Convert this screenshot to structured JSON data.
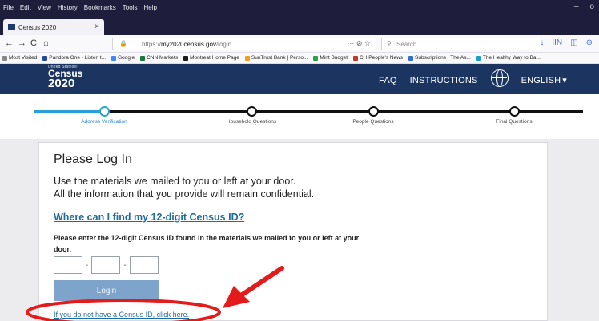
{
  "browser": {
    "menu": [
      "File",
      "Edit",
      "View",
      "History",
      "Bookmarks",
      "Tools",
      "Help"
    ],
    "window_controls": [
      "–",
      "o"
    ],
    "tab": {
      "title": "Census 2020",
      "close": "×"
    },
    "new_tab": "+",
    "nav": {
      "back": "←",
      "forward": "→",
      "reload": "C",
      "home": "⌂"
    },
    "url": {
      "prefix": "https://",
      "host": "my2020census.gov",
      "path": "/login"
    },
    "page_actions": "··· ⊘ ☆",
    "search_placeholder": "Search",
    "toolbar_icons": [
      "↓",
      "IIN",
      "◫",
      "⊕"
    ],
    "bookmarks": [
      {
        "label": "Most Visited",
        "color": "#888888"
      },
      {
        "label": "Pandora One - Listen t...",
        "color": "#224a9c"
      },
      {
        "label": "Google",
        "color": "#4285f4"
      },
      {
        "label": "CNN Markets",
        "color": "#1a7a3a"
      },
      {
        "label": "Montreat Home Page",
        "color": "#1a1a1a"
      },
      {
        "label": "SunTrust Bank | Perso...",
        "color": "#f0a020"
      },
      {
        "label": "Mint Budget",
        "color": "#2ea043"
      },
      {
        "label": "CH People's News",
        "color": "#c0392b"
      },
      {
        "label": "Subscriptions | The As...",
        "color": "#2e6fd8"
      },
      {
        "label": "The Healthy Way to Ba...",
        "color": "#1aa0c8"
      }
    ]
  },
  "site": {
    "logo": {
      "united": "United States®",
      "census": "Census",
      "year": "2020"
    },
    "nav": {
      "faq": "FAQ",
      "instructions": "INSTRUCTIONS",
      "language": "ENGLISH",
      "caret": "▾"
    },
    "colors": {
      "header": "#1c3560",
      "accent": "#2a9fd8",
      "link": "#1e6c9e",
      "button": "#7fa4cc"
    },
    "steps": [
      {
        "label": "Address Verification",
        "active": true
      },
      {
        "label": "Household Questions",
        "active": false
      },
      {
        "label": "People Questions",
        "active": false
      },
      {
        "label": "Final Questions",
        "active": false
      }
    ],
    "login": {
      "title": "Please Log In",
      "intro_line1": "Use the materials we mailed to you or left at your door.",
      "intro_line2": "All the information that you provide will remain confidential.",
      "help_link": "Where can I find my 12-digit Census ID?",
      "instruction": "Please enter the 12-digit Census ID found in the materials we mailed to you or left at your door.",
      "id_placeholders": [
        "",
        "",
        ""
      ],
      "dash": "-",
      "button": "Login",
      "no_id_link": "If you do not have a Census ID, click here."
    }
  }
}
